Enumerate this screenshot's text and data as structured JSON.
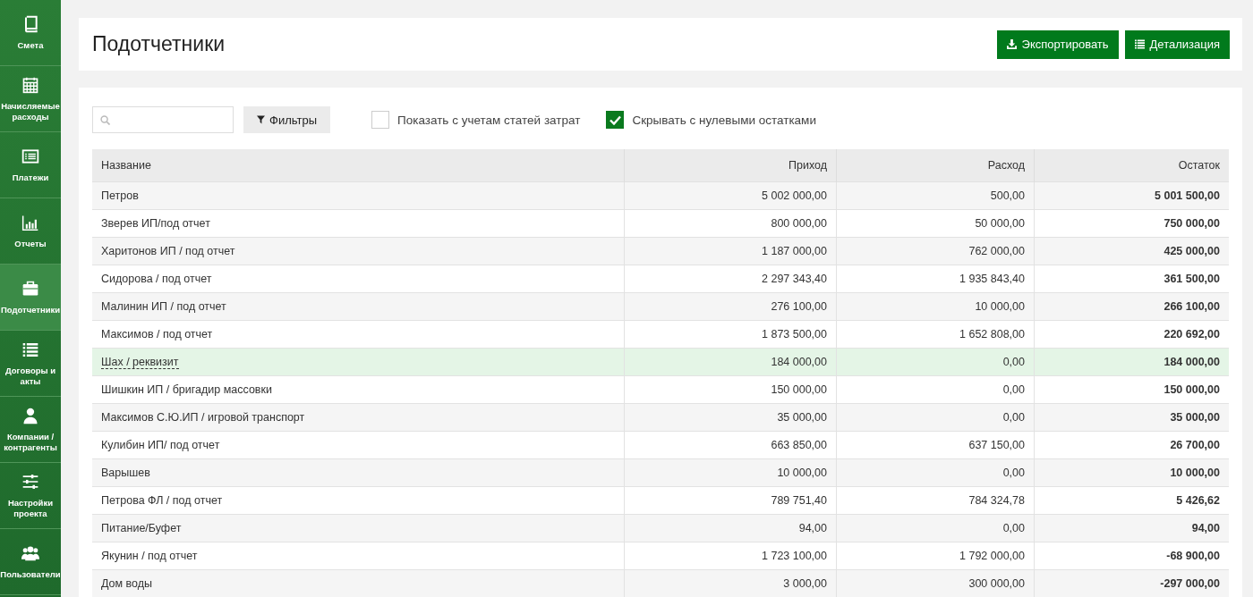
{
  "sidebar": {
    "items": [
      {
        "label": "Смета",
        "selected": false
      },
      {
        "label": "Начисляемые расходы",
        "selected": false
      },
      {
        "label": "Платежи",
        "selected": false
      },
      {
        "label": "Отчеты",
        "selected": false
      },
      {
        "label": "Подотчетники",
        "selected": true
      },
      {
        "label": "Договоры и акты",
        "selected": false
      },
      {
        "label": "Компании / контрагенты",
        "selected": false
      },
      {
        "label": "Настройки проекта",
        "selected": false
      },
      {
        "label": "Пользователи",
        "selected": false
      }
    ]
  },
  "header": {
    "title": "Подотчетники",
    "buttons": [
      "Экспортировать",
      "Детализация"
    ]
  },
  "toolbar": {
    "filter_button": "Фильтры",
    "checkboxes": [
      {
        "label": "Показать с учетам статей затрат",
        "checked": false
      },
      {
        "label": "Скрывать с нулевыми остатками",
        "checked": true
      }
    ]
  },
  "table": {
    "columns": [
      "Название",
      "Приход",
      "Расход",
      "Остаток"
    ],
    "rows": [
      {
        "cells": [
          "Петров",
          "5 002 000,00",
          "500,00",
          "5 001 500,00"
        ],
        "selected": false
      },
      {
        "cells": [
          "Зверев ИП/под отчет",
          "800 000,00",
          "50 000,00",
          "750 000,00"
        ],
        "selected": false
      },
      {
        "cells": [
          "Харитонов ИП / под отчет",
          "1 187 000,00",
          "762 000,00",
          "425 000,00"
        ],
        "selected": false
      },
      {
        "cells": [
          "Сидорова / под отчет",
          "2 297 343,40",
          "1 935 843,40",
          "361 500,00"
        ],
        "selected": false
      },
      {
        "cells": [
          "Малинин ИП / под отчет",
          "276 100,00",
          "10 000,00",
          "266 100,00"
        ],
        "selected": false
      },
      {
        "cells": [
          "Максимов / под отчет",
          "1 873 500,00",
          "1 652 808,00",
          "220 692,00"
        ],
        "selected": false
      },
      {
        "cells": [
          "Шах / реквизит",
          "184 000,00",
          "0,00",
          "184 000,00"
        ],
        "selected": true
      },
      {
        "cells": [
          "Шишкин ИП / бригадир массовки",
          "150 000,00",
          "0,00",
          "150 000,00"
        ],
        "selected": false
      },
      {
        "cells": [
          "Максимов С.Ю.ИП / игровой транспорт",
          "35 000,00",
          "0,00",
          "35 000,00"
        ],
        "selected": false
      },
      {
        "cells": [
          "Кулибин ИП/ под отчет",
          "663 850,00",
          "637 150,00",
          "26 700,00"
        ],
        "selected": false
      },
      {
        "cells": [
          "Варышев",
          "10 000,00",
          "0,00",
          "10 000,00"
        ],
        "selected": false
      },
      {
        "cells": [
          "Петрова ФЛ / под отчет",
          "789 751,40",
          "784 324,78",
          "5 426,62"
        ],
        "selected": false
      },
      {
        "cells": [
          "Питание/Буфет",
          "94,00",
          "0,00",
          "94,00"
        ],
        "selected": false
      },
      {
        "cells": [
          "Якунин / под отчет",
          "1 723 100,00",
          "1 792 000,00",
          "-68 900,00"
        ],
        "selected": false
      },
      {
        "cells": [
          "Дом воды",
          "3 000,00",
          "300 000,00",
          "-297 000,00"
        ],
        "selected": false
      }
    ]
  }
}
